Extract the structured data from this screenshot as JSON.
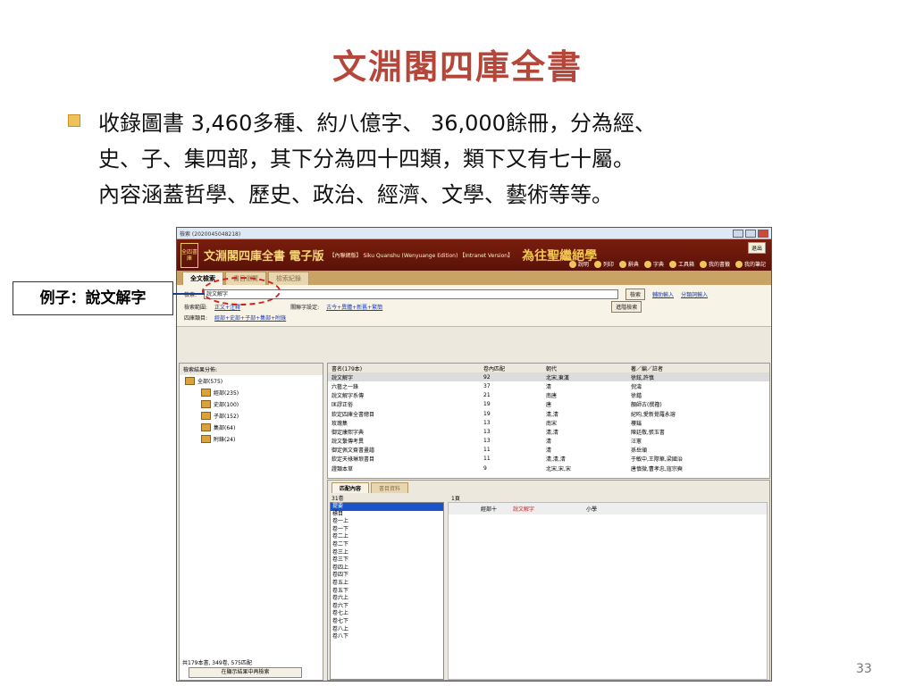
{
  "slide": {
    "title": "文淵閣四庫全書",
    "bullet_lines": [
      "收錄圖書 3,460多種、約八億字、 36,000餘冊，分為經、",
      "史、子、集四部，其下分為四十四類，類下又有七十屬。",
      "內容涵蓋哲學、歷史、政治、經濟、文學、藝術等等。"
    ],
    "callout": "例子：說文解字",
    "page_number": "33"
  },
  "app": {
    "window_title": "檢索 (2020045048218)",
    "logo": "全四書庫",
    "brand": "文淵閣四庫全書 電子版",
    "edition": "【內聯網版】 Siku Quanshu (Wenyuange Edition) 【Intranet Version】",
    "slogan": "為往聖繼絕學",
    "exit": "退出",
    "tools": [
      "說明",
      "列印",
      "辭典",
      "字典",
      "工具箱",
      "我的書籤",
      "我的筆記"
    ],
    "tabs": [
      "全文檢索",
      "書目瀏覽",
      "檢索紀錄"
    ],
    "search": {
      "label": "檢索:",
      "value": "說文解字",
      "search_btn": "檢索",
      "assist_links": [
        "輔助輸入",
        "分類詞輸入"
      ],
      "range_label": "檢索範圍:",
      "range_value": "正文+注釋",
      "related_label": "關聯字設定:",
      "related_value": "古今+異體+新舊+繁簡",
      "advanced_btn": "進階檢索",
      "category_label": "四庫類目:",
      "category_value": "經部+史部+子部+集部+附錄"
    },
    "tree": {
      "header": "檢索結果分佈:",
      "items": [
        {
          "label": "全部(575)",
          "level": 0
        },
        {
          "label": "經部(235)",
          "level": 1
        },
        {
          "label": "史部(100)",
          "level": 1
        },
        {
          "label": "子部(152)",
          "level": 1
        },
        {
          "label": "集部(64)",
          "level": 1
        },
        {
          "label": "附錄(24)",
          "level": 1
        }
      ],
      "summary": "共179本書, 349卷, 575匹配",
      "refine_btn": "在顯示結果中再檢索"
    },
    "results": {
      "headers": [
        "書名(179本)",
        "卷內匹配",
        "朝代",
        "著／編／註者"
      ],
      "rows": [
        [
          "說文解字",
          "92",
          "北宋,東漢",
          "徐鉉,許慎"
        ],
        [
          "六藝之一錄",
          "37",
          "清",
          "倪濤"
        ],
        [
          "說文解字系傳",
          "21",
          "南唐",
          "徐鍇"
        ],
        [
          "匡謬正俗",
          "19",
          "唐",
          "顏師古(撰籀)"
        ],
        [
          "欽定四庫全書總目",
          "19",
          "清,清",
          "紀昀,愛新覺羅永瑢"
        ],
        [
          "玫瑰集",
          "13",
          "南宋",
          "樓鑰"
        ],
        [
          "御定康熙字典",
          "13",
          "清,清",
          "陳廷敬,張玉書"
        ],
        [
          "說文繫傳考異",
          "13",
          "清",
          "汪憲"
        ],
        [
          "御定佩文齋書畫譜",
          "11",
          "清",
          "孫岳頒"
        ],
        [
          "欽定天祿琳琅書目",
          "11",
          "清,清,清",
          "于敏中,王際華,梁國治"
        ],
        [
          "證類本草",
          "9",
          "北宋,宋,宋",
          "唐慎微,曹孝忠,寇宗奭"
        ]
      ]
    },
    "detail": {
      "tabs": [
        "匹配內容",
        "書目資料"
      ],
      "count": "31卷",
      "page": "1頁",
      "list": [
        "提要",
        "標目",
        "卷一上",
        "卷一下",
        "卷二上",
        "卷二下",
        "卷三上",
        "卷三下",
        "卷四上",
        "卷四下",
        "卷五上",
        "卷五下",
        "卷六上",
        "卷六下",
        "卷七上",
        "卷七下",
        "卷八上",
        "卷八下"
      ],
      "line": [
        "經部十",
        "說文解字",
        "小學"
      ]
    }
  }
}
